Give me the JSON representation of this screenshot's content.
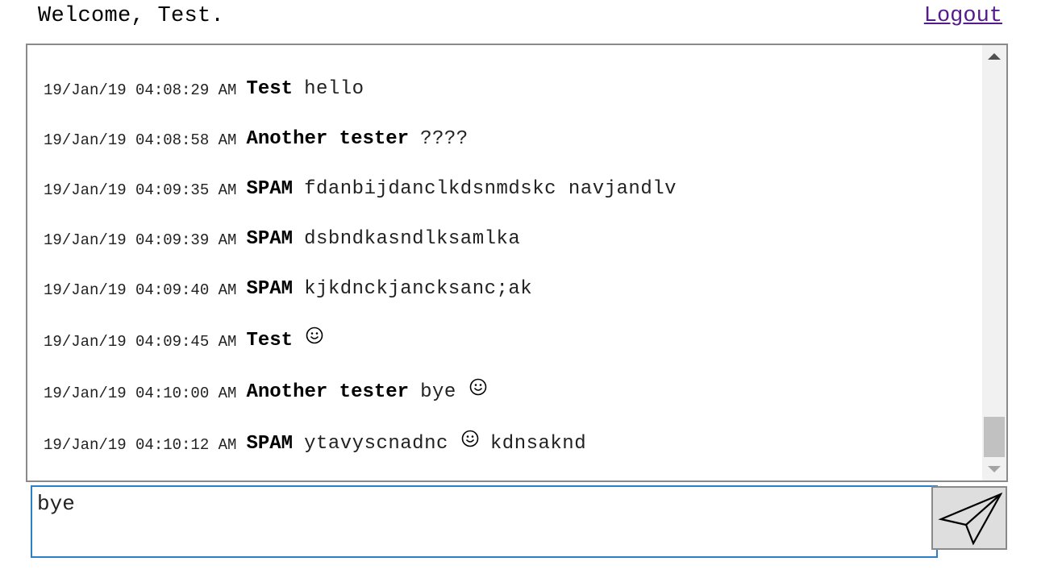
{
  "header": {
    "welcome_text": "Welcome, Test.",
    "logout_label": "Logout"
  },
  "messages": [
    {
      "time": "19/Jan/19 04:08:29 AM",
      "user": "Test",
      "text": "hello"
    },
    {
      "time": "19/Jan/19 04:08:58 AM",
      "user": "Another tester",
      "text": "????"
    },
    {
      "time": "19/Jan/19 04:09:35 AM",
      "user": "SPAM",
      "text": "fdanbijdanclkdsnmdskc navjandlv"
    },
    {
      "time": "19/Jan/19 04:09:39 AM",
      "user": "SPAM",
      "text": "dsbndkasndlksamlka"
    },
    {
      "time": "19/Jan/19 04:09:40 AM",
      "user": "SPAM",
      "text": "kjkdnckjancksanc;ak"
    },
    {
      "time": "19/Jan/19 04:09:45 AM",
      "user": "Test",
      "text": "",
      "emoji": "smiley-icon"
    },
    {
      "time": "19/Jan/19 04:10:00 AM",
      "user": "Another tester",
      "text": "bye",
      "emoji": "smiley-icon"
    },
    {
      "time": "19/Jan/19 04:10:12 AM",
      "user": "SPAM",
      "text": "ytavyscnadnc",
      "emoji": "smiley-icon",
      "text_after": "kdnsaknd"
    }
  ],
  "composer": {
    "value": "bye",
    "send_icon": "paper-plane-icon"
  },
  "colors": {
    "input_border": "#2a7fc6",
    "link": "#551a8b",
    "send_button_bg": "#dedede"
  }
}
